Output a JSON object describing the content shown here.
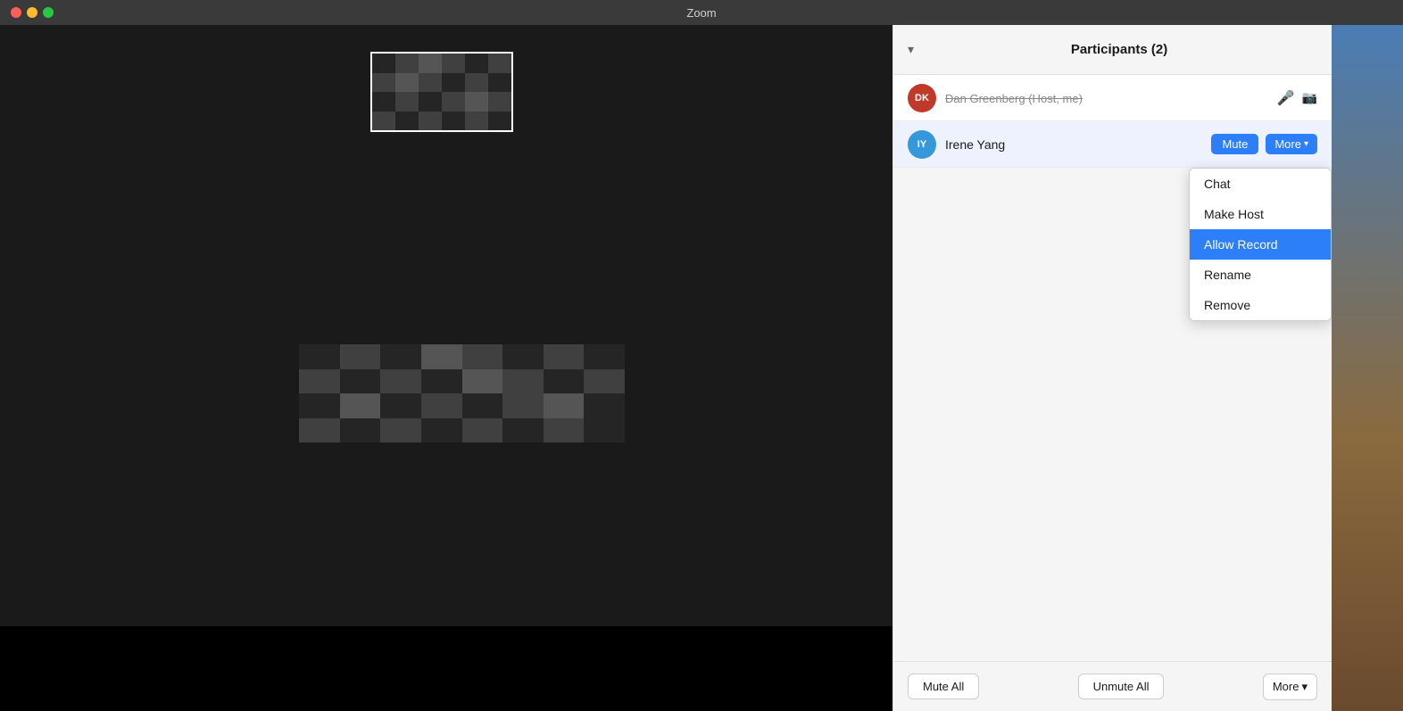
{
  "titlebar": {
    "title": "Zoom"
  },
  "sidebar": {
    "header": {
      "title": "Participants (2)",
      "chevron": "▾"
    },
    "participants": [
      {
        "id": "dk",
        "initials": "DK",
        "name": "Dan Greenberg (Host, me)",
        "avatarClass": "avatar-dk",
        "micIcon": "🎤",
        "videoOffIcon": "📵",
        "showMuteButton": false,
        "showMoreButton": false
      },
      {
        "id": "iy",
        "initials": "IY",
        "name": "Irene Yang",
        "avatarClass": "avatar-iy",
        "showMuteButton": true,
        "showMoreButton": true,
        "muteLabel": "Mute",
        "moreLabel": "More"
      }
    ],
    "dropdown": {
      "items": [
        {
          "label": "Chat",
          "active": false
        },
        {
          "label": "Make Host",
          "active": false
        },
        {
          "label": "Allow Record",
          "active": true
        },
        {
          "label": "Rename",
          "active": false
        },
        {
          "label": "Remove",
          "active": false
        }
      ]
    },
    "footer": {
      "muteAllLabel": "Mute All",
      "unmuteAllLabel": "Unmute All",
      "moreLabel": "More",
      "chevron": "▾"
    }
  }
}
